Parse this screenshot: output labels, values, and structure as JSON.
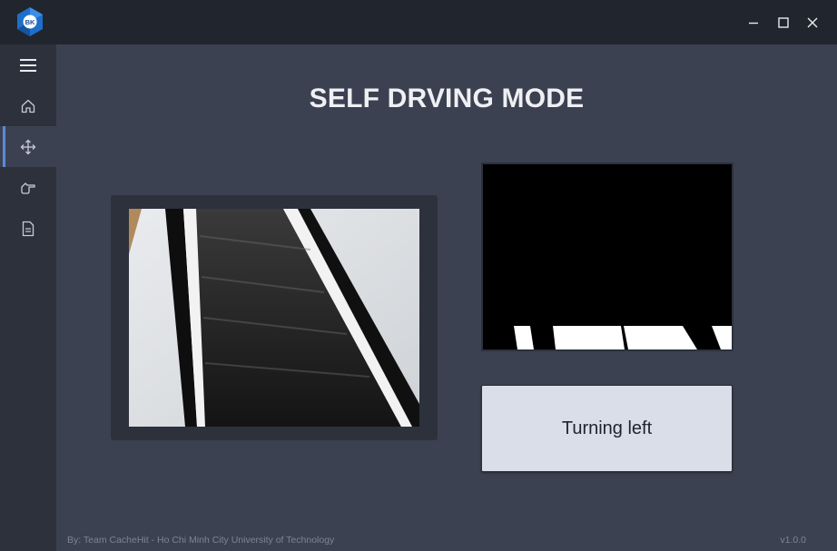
{
  "app": {
    "logo_text": "BK"
  },
  "window_controls": {
    "minimize": "minimize-icon",
    "maximize": "maximize-icon",
    "close": "close-icon"
  },
  "sidebar": {
    "menu_icon": "hamburger-menu-icon",
    "items": [
      {
        "name": "home",
        "icon": "home-icon",
        "active": false
      },
      {
        "name": "self-driving",
        "icon": "move-arrows-icon",
        "active": true
      },
      {
        "name": "manual-control",
        "icon": "hand-pointer-icon",
        "active": false
      },
      {
        "name": "report",
        "icon": "document-icon",
        "active": false
      }
    ]
  },
  "main": {
    "title": "SELF DRVING MODE",
    "status_text": "Turning left"
  },
  "footer": {
    "credit": "By: Team CacheHit - Ho Chi Minh City University of Technology",
    "version": "v1.0.0"
  },
  "colors": {
    "background": "#3b4150",
    "sidebar": "#2c313c",
    "titlebar": "#21252e",
    "accent": "#5b8ad6",
    "status_box": "#dadee9"
  }
}
